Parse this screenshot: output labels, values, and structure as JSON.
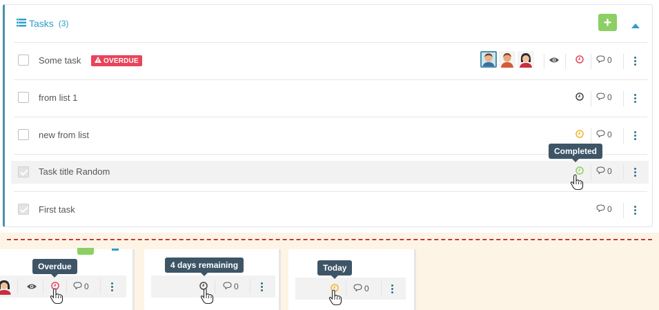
{
  "panel": {
    "title": "Tasks",
    "count": "(3)",
    "add_label": "+",
    "icons": {
      "list": "list-icon",
      "collapse": "caret-up-icon",
      "add": "plus-icon"
    }
  },
  "tasks": [
    {
      "title": "Some task",
      "checked": false,
      "badge": "OVERDUE",
      "comments": "0",
      "clock_status": "overdue"
    },
    {
      "title": "from list 1",
      "checked": false,
      "comments": "0",
      "clock_status": "remaining"
    },
    {
      "title": "new from list",
      "checked": false,
      "comments": "0",
      "clock_status": "today"
    },
    {
      "title": "Task title Random",
      "checked": true,
      "comments": "0",
      "clock_status": "completed",
      "tooltip": "Completed"
    },
    {
      "title": "First task",
      "checked": true,
      "comments": "0"
    }
  ],
  "examples": [
    {
      "tooltip": "Overdue",
      "comments": "0",
      "clock_status": "overdue"
    },
    {
      "tooltip": "4 days remaining",
      "comments": "0",
      "clock_status": "remaining"
    },
    {
      "tooltip": "Today",
      "comments": "0",
      "clock_status": "today"
    }
  ],
  "colors": {
    "accent": "#2e9ec9",
    "overdue": "#e8455a",
    "today": "#f0b323",
    "completed": "#8ccf63",
    "remaining": "#444444",
    "tooltip_bg": "#3d5566",
    "add_button": "#8ccf63",
    "separator": "#c0393b"
  }
}
